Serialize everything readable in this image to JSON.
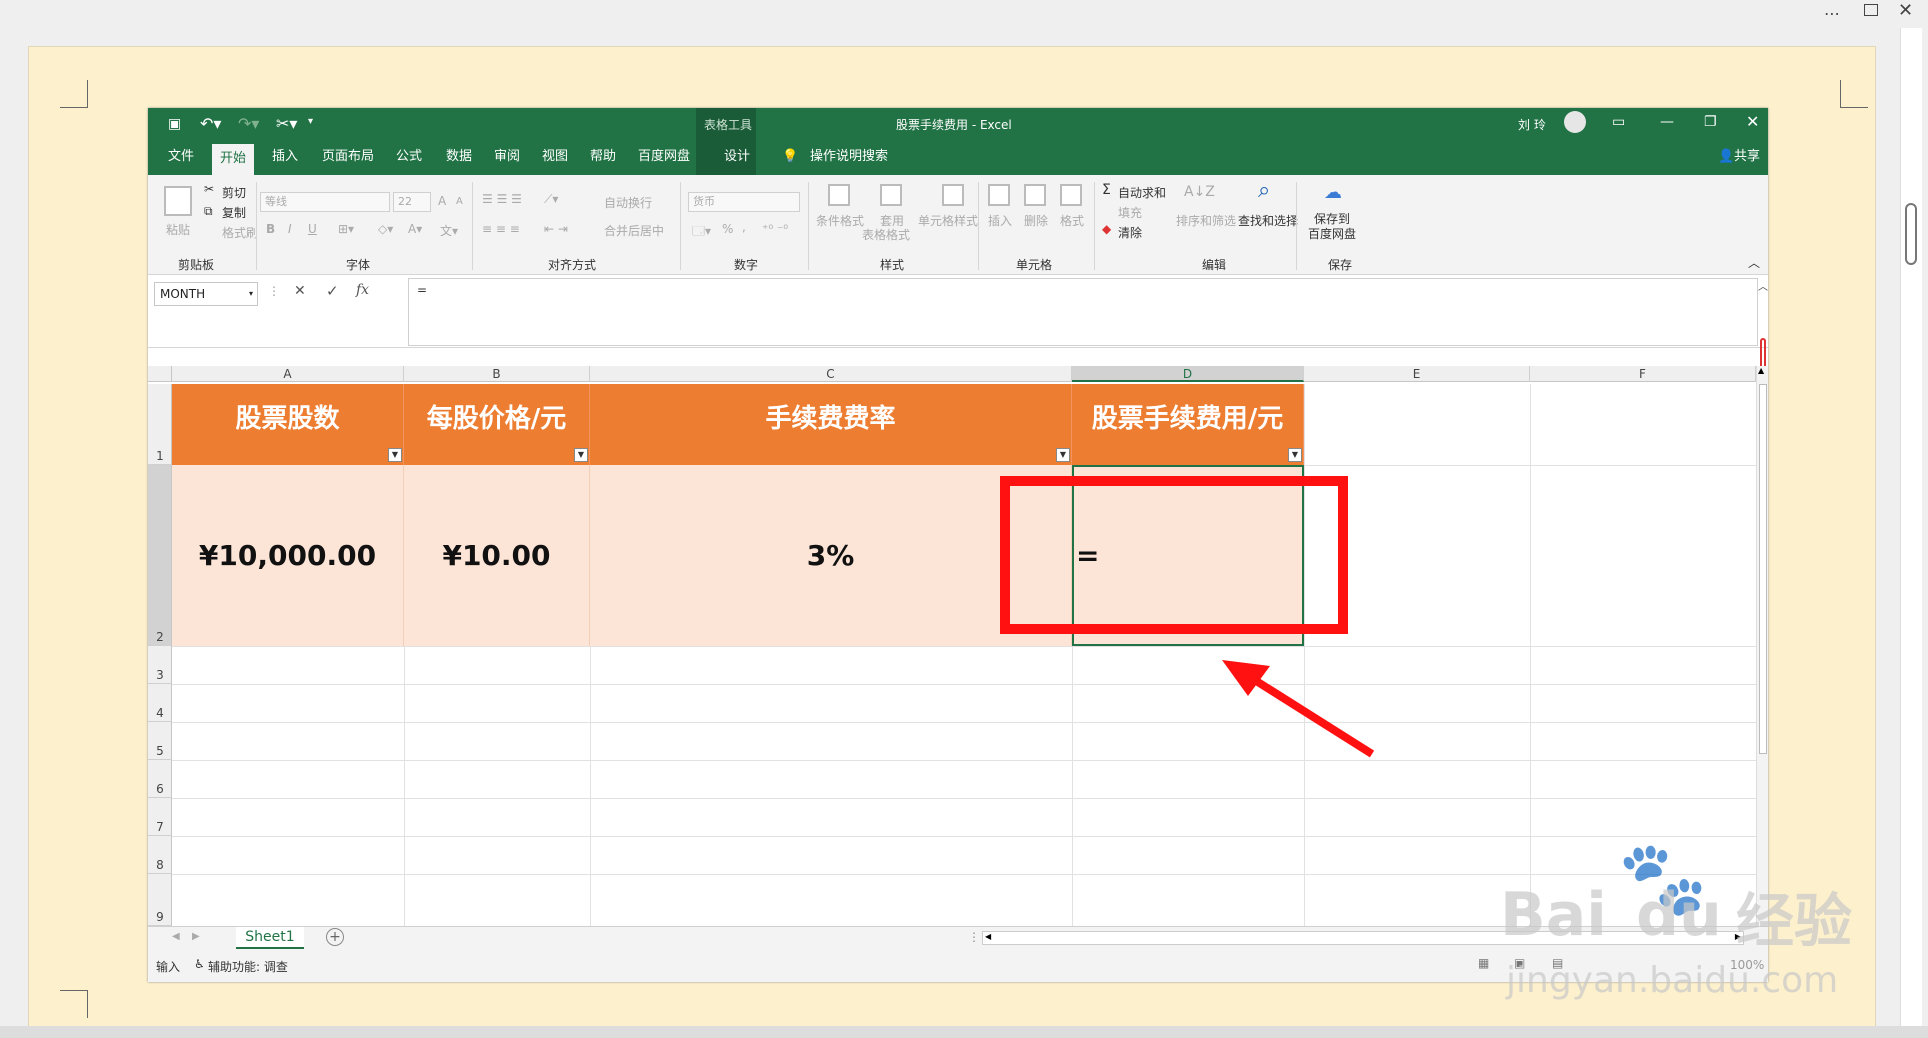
{
  "window": {
    "more_icon": "more-icon",
    "restore_icon": "window-restore-icon",
    "close_icon": "close-icon"
  },
  "excel": {
    "title": "股票手续费用 - Excel",
    "table_tools": "表格工具",
    "user_name": "刘 玲",
    "tabs": [
      "文件",
      "开始",
      "插入",
      "页面布局",
      "公式",
      "数据",
      "审阅",
      "视图",
      "帮助",
      "百度网盘",
      "设计"
    ],
    "tell_me": "操作说明搜索",
    "share": "共享",
    "ribbon": {
      "clipboard": {
        "paste": "粘贴",
        "cut": "剪切",
        "copy": "复制",
        "format_painter": "格式刷",
        "group": "剪贴板"
      },
      "font": {
        "name": "等线",
        "size": "22",
        "group": "字体",
        "bold": "B",
        "italic": "I",
        "underline": "U",
        "grow": "A",
        "shrink": "A"
      },
      "alignment": {
        "wrap": "自动换行",
        "merge": "合并后居中",
        "group": "对齐方式"
      },
      "number": {
        "format": "货币",
        "percent": "%",
        "comma": ",",
        "group": "数字"
      },
      "styles": {
        "conditional": "条件格式",
        "table_format_1": "套用",
        "table_format_2": "表格格式",
        "cell_styles": "单元格样式",
        "group": "样式"
      },
      "cells": {
        "insert": "插入",
        "delete": "删除",
        "format": "格式",
        "group": "单元格"
      },
      "editing": {
        "autosum": "自动求和",
        "fill": "填充",
        "clear": "清除",
        "sort": "排序和筛选",
        "find": "查找和选择",
        "group": "编辑"
      },
      "save": {
        "label1": "保存到",
        "label2": "百度网盘",
        "group": "保存"
      }
    },
    "formula_bar": {
      "name_box": "MONTH",
      "formula": "=",
      "cancel": "✕",
      "enter": "✓",
      "fx": "fx"
    },
    "columns": [
      "A",
      "B",
      "C",
      "D",
      "E",
      "F"
    ],
    "rows": [
      "1",
      "2",
      "3",
      "4",
      "5",
      "6",
      "7",
      "8",
      "9"
    ],
    "headers": [
      "股票股数",
      "每股价格/元",
      "手续费费率",
      "股票手续费用/元"
    ],
    "values": [
      "¥10,000.00",
      "¥10.00",
      "3%",
      "="
    ],
    "sheet_tab": "Sheet1",
    "status": {
      "mode": "输入",
      "accessibility": "辅助功能: 调查",
      "zoom": "100%"
    }
  },
  "watermark": {
    "brand": "Bai",
    "brand2": "du",
    "cn": "经验",
    "url": "jingyan.baidu.com"
  },
  "accent_colors": {
    "excel_green": "#217346",
    "header_orange": "#ed7d31",
    "data_peach": "#fce4d6",
    "highlight_red": "#ff1111"
  }
}
